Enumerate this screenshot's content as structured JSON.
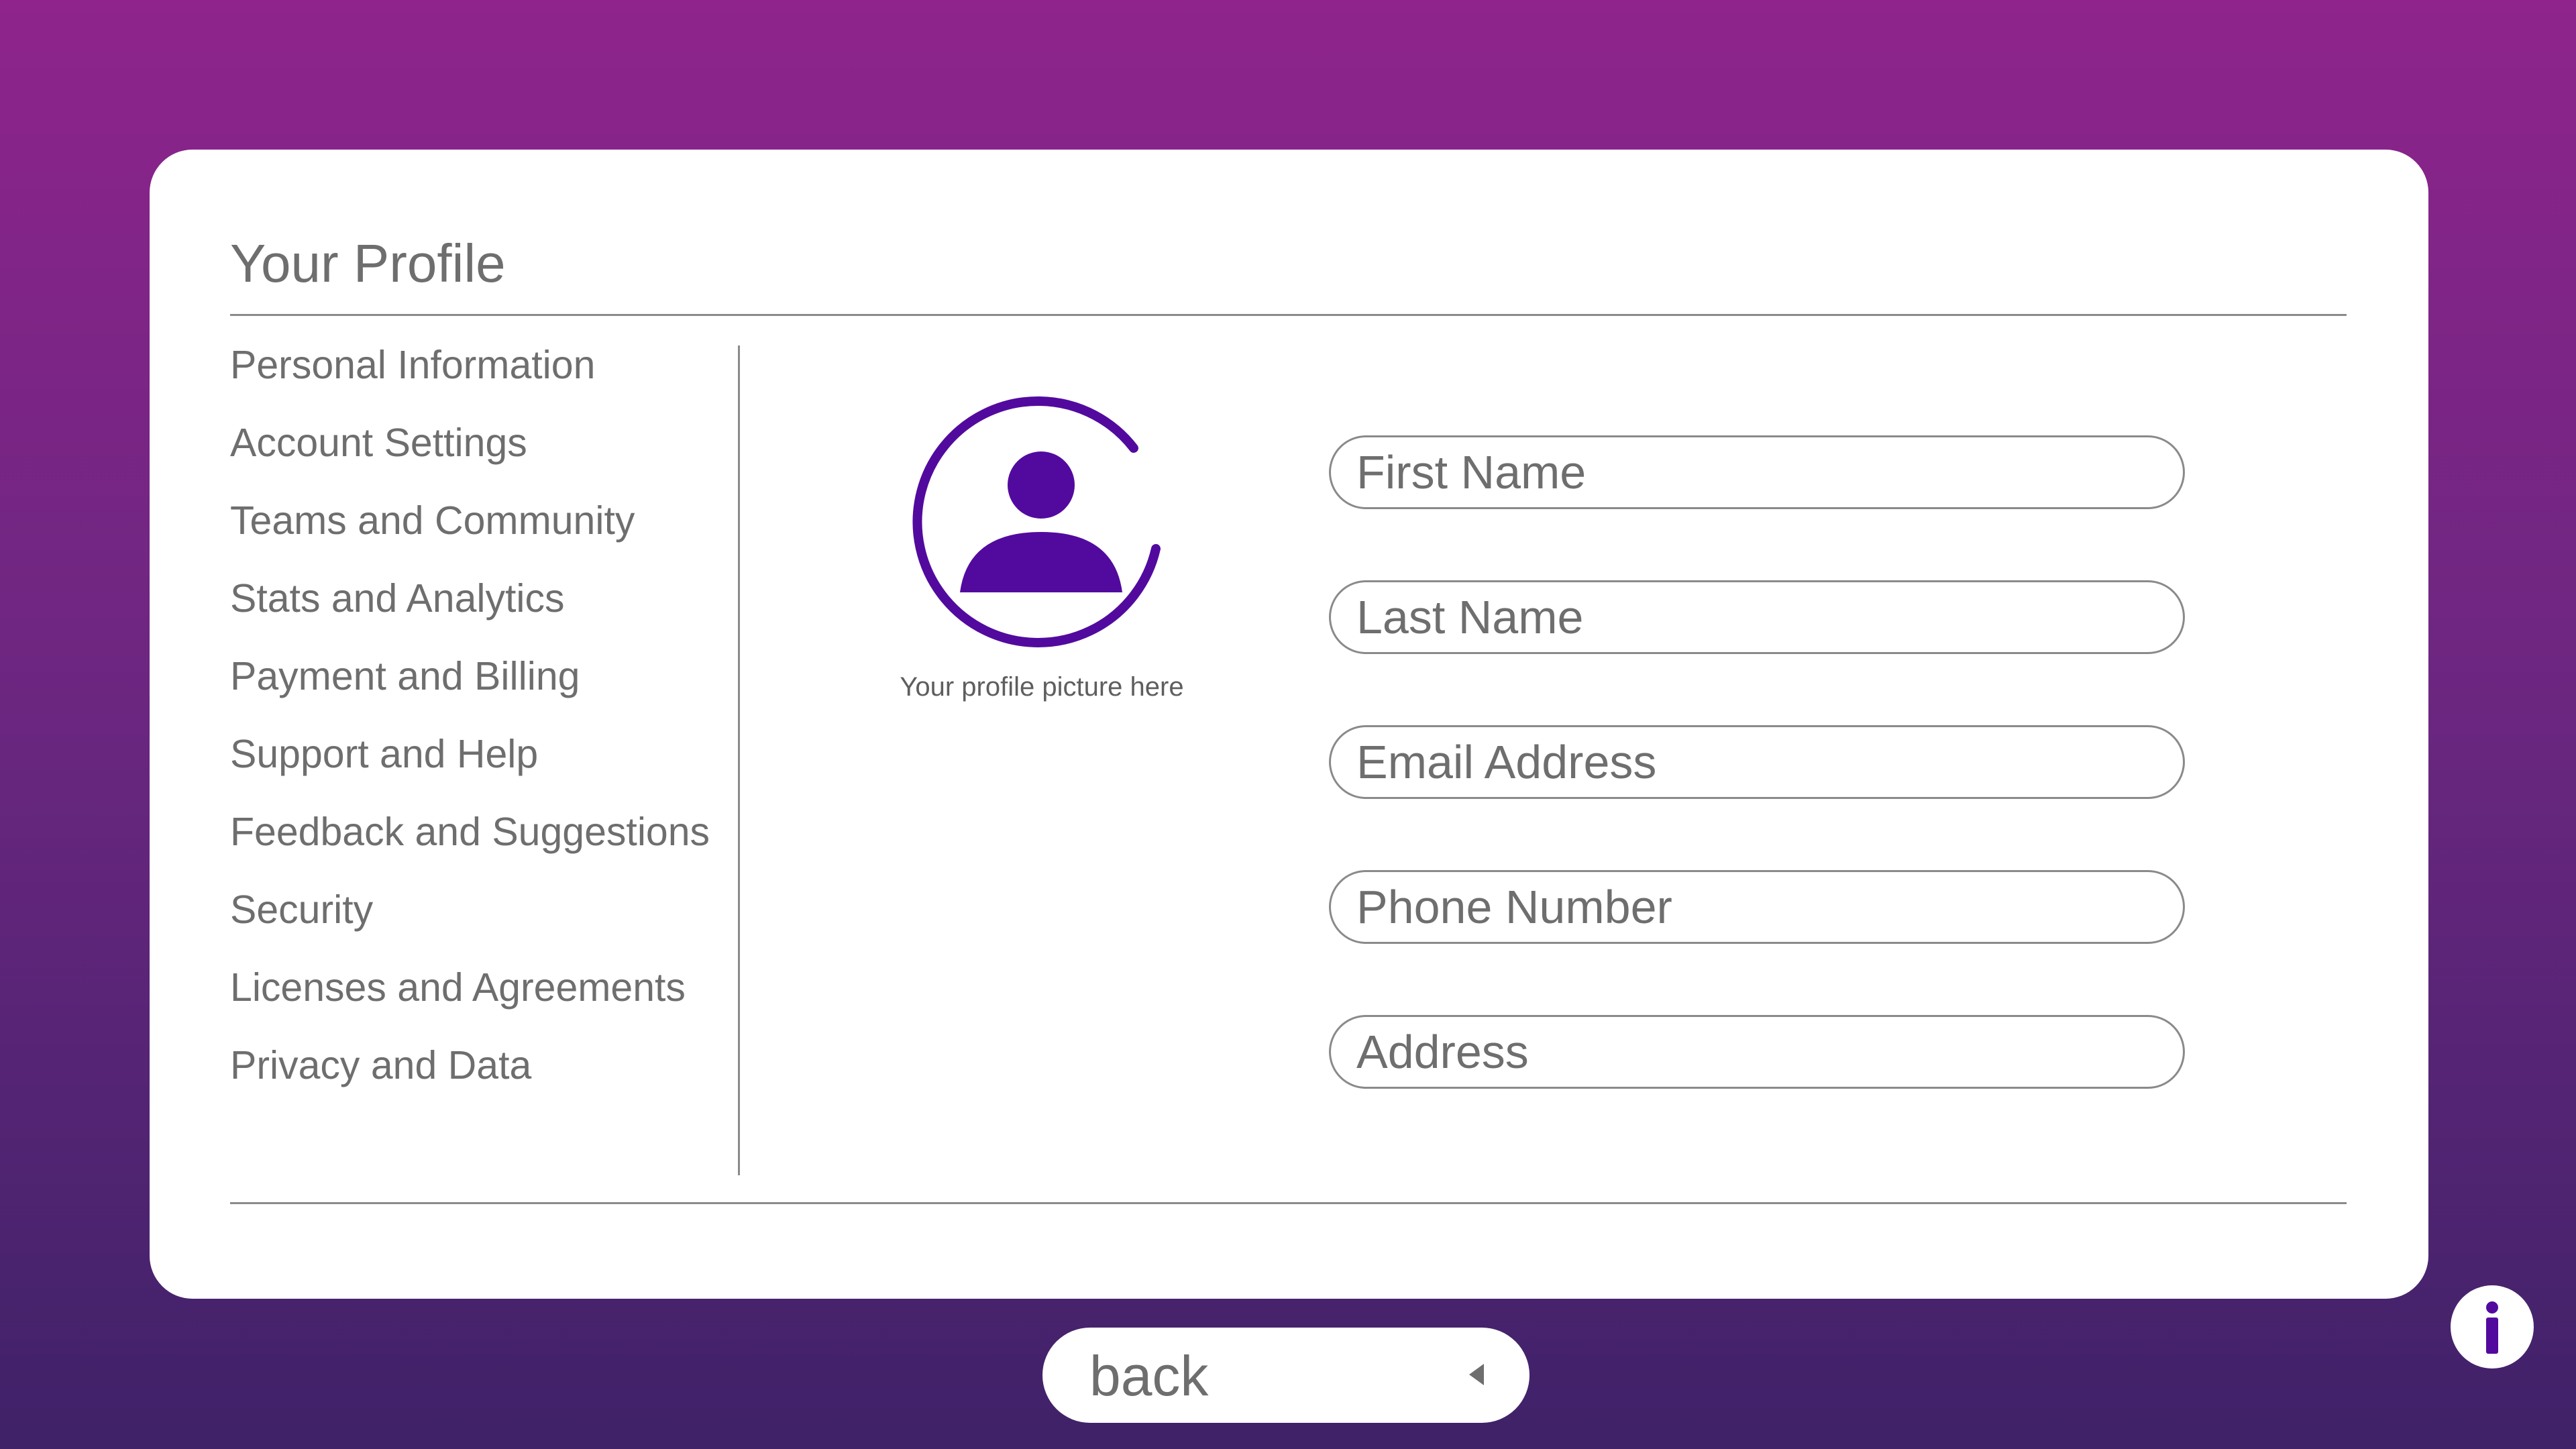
{
  "card": {
    "title": "Your Profile"
  },
  "sidebar": {
    "items": [
      {
        "label": "Personal Information"
      },
      {
        "label": "Account Settings"
      },
      {
        "label": "Teams and Community"
      },
      {
        "label": "Stats and Analytics"
      },
      {
        "label": "Payment and Billing"
      },
      {
        "label": "Support and Help"
      },
      {
        "label": "Feedback and Suggestions"
      },
      {
        "label": "Security"
      },
      {
        "label": "Licenses and Agreements"
      },
      {
        "label": "Privacy and Data"
      }
    ]
  },
  "avatar": {
    "icon": "user-avatar-icon",
    "caption": "Your profile picture here"
  },
  "form": {
    "first_name": {
      "placeholder": "First Name",
      "value": ""
    },
    "last_name": {
      "placeholder": "Last Name",
      "value": ""
    },
    "email": {
      "placeholder": "Email Address",
      "value": ""
    },
    "phone": {
      "placeholder": "Phone Number",
      "value": ""
    },
    "address": {
      "placeholder": "Address",
      "value": ""
    }
  },
  "footer": {
    "back_label": "back",
    "back_icon": "caret-left-icon",
    "info_icon": "info-icon"
  },
  "colors": {
    "accent": "#520a9e",
    "bg_top": "#8e248c",
    "bg_bottom": "#3f2268",
    "text": "#6e6e6e"
  }
}
